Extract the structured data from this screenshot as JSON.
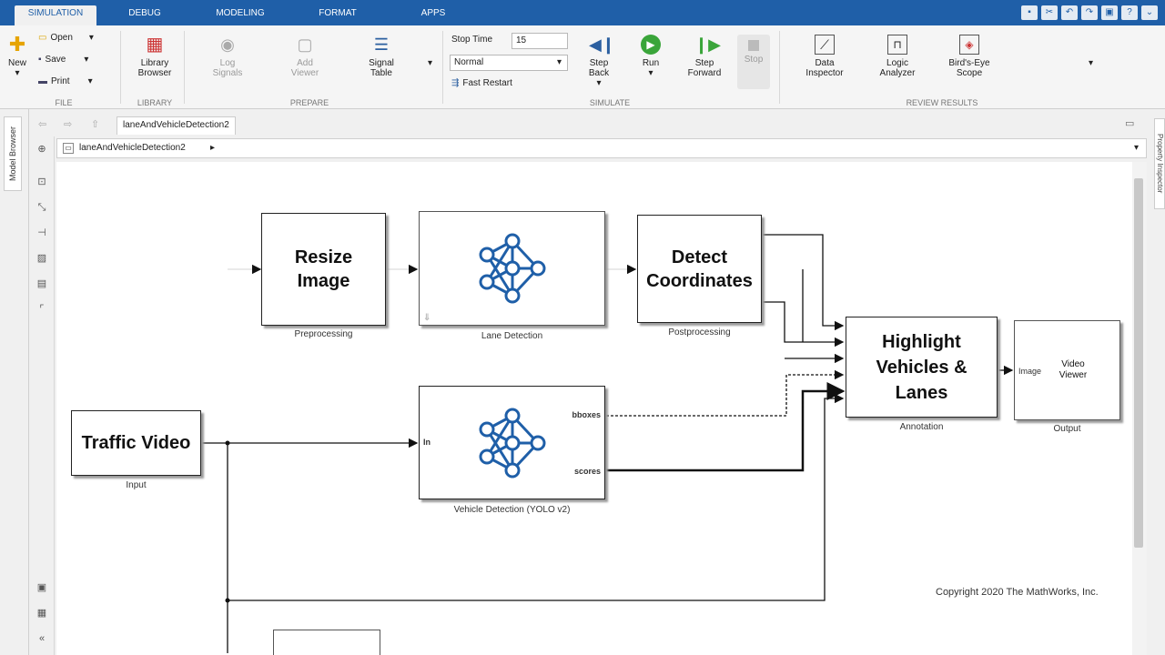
{
  "tabs": [
    "SIMULATION",
    "DEBUG",
    "MODELING",
    "FORMAT",
    "APPS"
  ],
  "ribbon": {
    "file": {
      "new": "New",
      "open": "Open",
      "save": "Save",
      "print": "Print",
      "group": "FILE"
    },
    "library": {
      "label": "Library Browser",
      "group": "LIBRARY"
    },
    "prepare": {
      "log": "Log Signals",
      "add_viewer": "Add Viewer",
      "signal_table": "Signal Table",
      "group": "PREPARE"
    },
    "simulate": {
      "stop_time_label": "Stop Time",
      "stop_time_value": "15",
      "mode": "Normal",
      "fast_restart": "Fast Restart",
      "step_back": "Step Back",
      "run": "Run",
      "step_forward": "Step Forward",
      "stop": "Stop",
      "group": "SIMULATE"
    },
    "review": {
      "data_inspector": "Data Inspector",
      "logic_analyzer": "Logic Analyzer",
      "birds_eye": "Bird's-Eye Scope",
      "group": "REVIEW RESULTS"
    }
  },
  "model_browser_tab": "Model Browser",
  "property_tab": "Property Inspector",
  "model_tab": "laneAndVehicleDetection2",
  "breadcrumb": "laneAndVehicleDetection2",
  "blocks": {
    "traffic": {
      "title": "Traffic Video",
      "caption": "Input"
    },
    "resize": {
      "title": "Resize Image",
      "caption": "Preprocessing"
    },
    "lane": {
      "caption": "Lane Detection"
    },
    "detect": {
      "title": "Detect Coordinates",
      "caption": "Postprocessing"
    },
    "vehicle": {
      "caption": "Vehicle Detection (YOLO v2)",
      "port_in": "In",
      "port_bboxes": "bboxes",
      "port_scores": "scores"
    },
    "highlight": {
      "title": "Highlight Vehicles & Lanes",
      "caption": "Annotation"
    },
    "viewer": {
      "title": "Video Viewer",
      "port_in": "Image",
      "caption": "Output"
    }
  },
  "copyright": "Copyright 2020 The MathWorks, Inc."
}
